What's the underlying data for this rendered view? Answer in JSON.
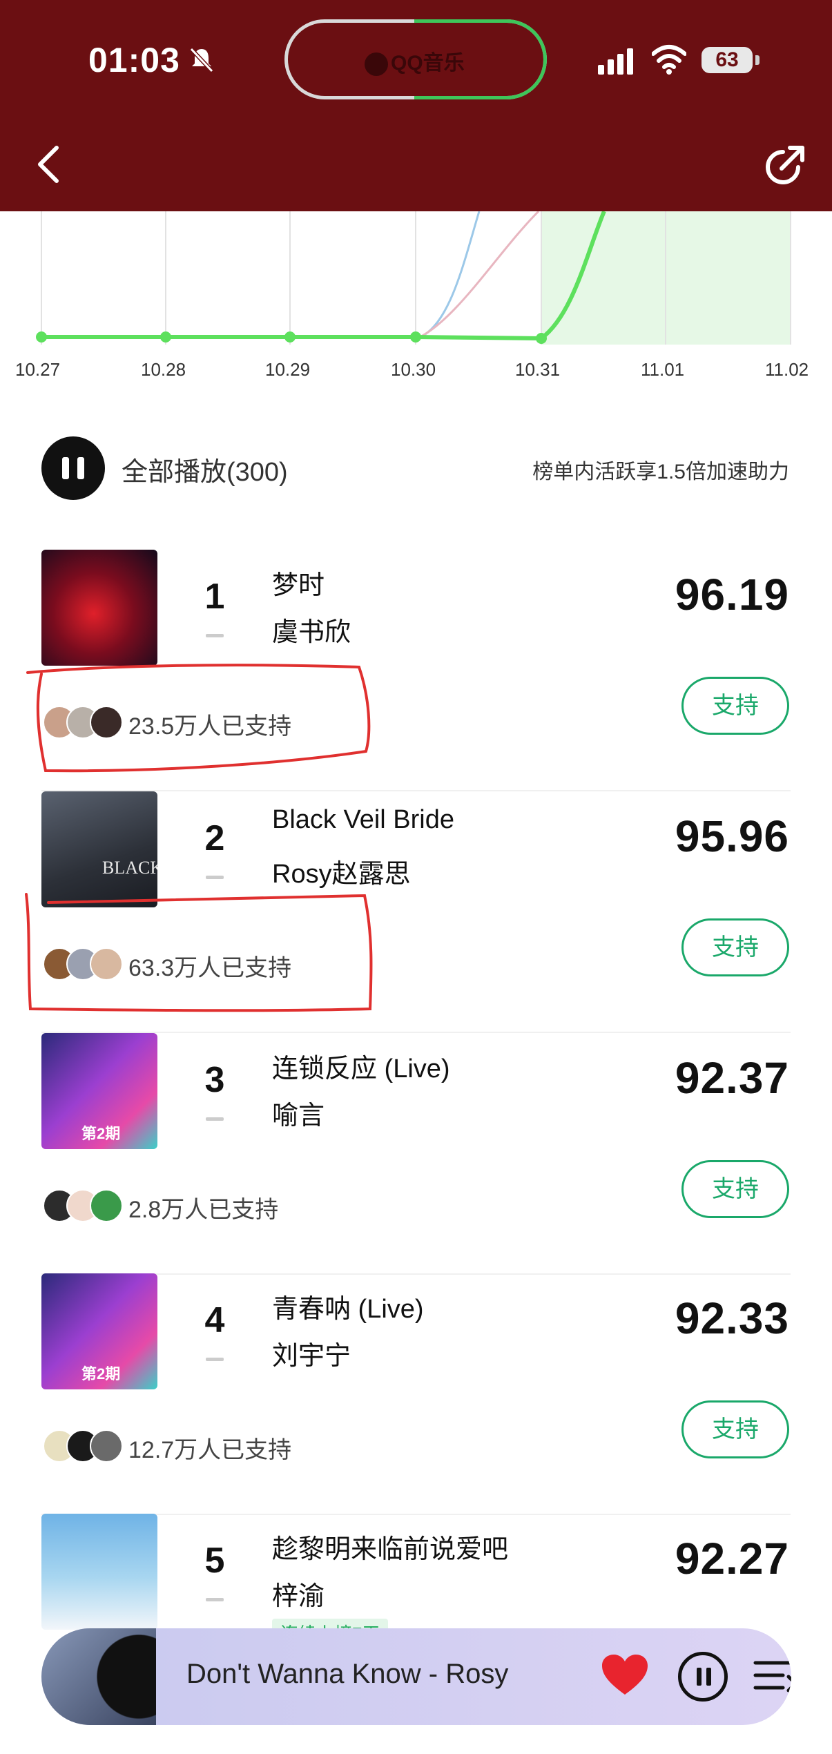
{
  "status_bar": {
    "time": "01:03",
    "island_app": "QQ音乐",
    "battery": "63"
  },
  "chart_data": {
    "type": "line",
    "categories": [
      "10.27",
      "10.28",
      "10.29",
      "10.30",
      "10.31",
      "11.01",
      "11.02"
    ],
    "colors": {
      "main": "#5de05d",
      "fill": "#e6f8e6",
      "others": [
        "#9cc8e8",
        "#e8b6c0"
      ]
    }
  },
  "play_all": {
    "label": "全部播放(300)",
    "note": "榜单内活跃享1.5倍加速助力"
  },
  "songs": [
    {
      "rank": "1",
      "title": "梦时",
      "artist": "虞书欣",
      "score": "96.19",
      "supporters": "23.5万人已支持",
      "support_label": "支持"
    },
    {
      "rank": "2",
      "title": "Black Veil Bride",
      "artist": "Rosy赵露思",
      "score": "95.96",
      "supporters": "63.3万人已支持",
      "support_label": "支持",
      "cover_text": "BLACK"
    },
    {
      "rank": "3",
      "title": "连锁反应 (Live)",
      "artist": "喻言",
      "score": "92.37",
      "supporters": "2.8万人已支持",
      "support_label": "支持",
      "cover_text": "第2期"
    },
    {
      "rank": "4",
      "title": "青春呐 (Live)",
      "artist": "刘宇宁",
      "score": "92.33",
      "supporters": "12.7万人已支持",
      "support_label": "支持",
      "cover_text": "第2期"
    },
    {
      "rank": "5",
      "title": "趁黎明来临前说爱吧",
      "artist": "梓渝",
      "score": "92.27",
      "badge": "连续上榜7天"
    }
  ],
  "player": {
    "now_playing": "Don't Wanna Know - Rosy"
  }
}
